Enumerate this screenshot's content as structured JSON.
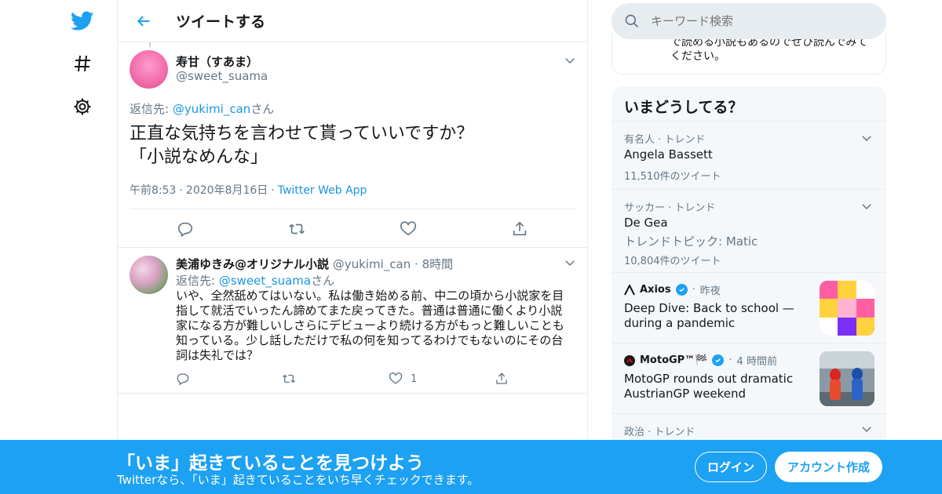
{
  "colors": {
    "accent": "#1da1f2",
    "text": "#14171a",
    "muted": "#657786",
    "border": "#e6ecf0",
    "link": "#1b95e0"
  },
  "nav": {
    "icons": [
      "twitter-logo-icon",
      "hashtag-icon",
      "gear-icon"
    ]
  },
  "header": {
    "title": "ツイートする"
  },
  "tweet": {
    "author_name": "寿甘（すあま）",
    "author_handle": "@sweet_suama",
    "reply_prefix": "返信先: ",
    "reply_to": "@yukimi_can",
    "reply_suffix": "さん",
    "text_line1": "正直な気持ちを言わせて貰っていいですか？",
    "text_line2": "「小説なめんな」",
    "time": "午前8:53",
    "date": "2020年8月16日",
    "source": "Twitter Web App"
  },
  "reply": {
    "author_name": "美浦ゆきみ@オリジナル小説",
    "author_handle": "@yukimi_can",
    "time": "8時間",
    "reply_prefix": "返信先: ",
    "reply_to": "@sweet_suama",
    "reply_suffix": "さん",
    "text": "いや、全然舐めてはいない。私は働き始める前、中二の頃から小説家を目指して就活でいったん諦めてまた戻ってきた。普通は普通に働くより小説家になる方が難しいしさらにデビューより続ける方がもっと難しいことも知っている。少し話しただけで私の何を知ってるわけでもないのにその台詞は失礼では？",
    "like_count": "1"
  },
  "search": {
    "placeholder": "キーワード検索"
  },
  "sidebar_prev": {
    "text": "で読める小説もあるのでぜひ読んでみてください。"
  },
  "trends": {
    "title": "いまどうしてる？",
    "items": [
      {
        "meta": "有名人 · トレンド",
        "name": "Angela Bassett",
        "count": "11,510件のツイート"
      },
      {
        "meta": "サッカー · トレンド",
        "name": "De Gea",
        "topic": "トレンドトピック: Matic",
        "count": "10,804件のツイート"
      }
    ],
    "news": [
      {
        "source": "Axios",
        "time": "昨夜",
        "title": "Deep Dive: Back to school — during a pandemic"
      },
      {
        "source": "MotoGP™🏁",
        "time": "4 時間前",
        "title": "MotoGP rounds out dramatic AustrianGP weekend"
      }
    ],
    "last_meta": "政治 · トレンド"
  },
  "banner": {
    "title": "「いま」起きていることを見つけよう",
    "subtitle": "Twitterなら、「いま」起きていることをいち早くチェックできます。",
    "login": "ログイン",
    "signup": "アカウント作成"
  }
}
